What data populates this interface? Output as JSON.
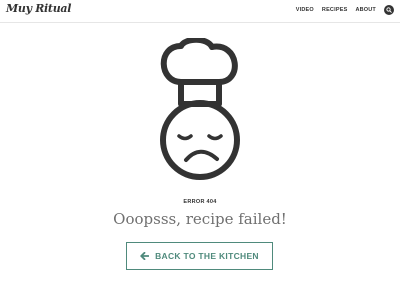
{
  "header": {
    "logo_text": "Muy Ritual",
    "nav": [
      {
        "label": "VIDEO"
      },
      {
        "label": "RECIPES"
      },
      {
        "label": "ABOUT"
      }
    ],
    "search_icon": "search-icon"
  },
  "main": {
    "illustration_icon": "sad-chef-icon",
    "error_code": "ERROR 404",
    "headline": "Ooopsss, recipe failed!",
    "back_button": {
      "label": "BACK TO THE KITCHEN",
      "icon": "arrow-left-icon"
    }
  },
  "colors": {
    "accent": "#4f8a7c",
    "text": "#333333",
    "headline": "#707070",
    "divider": "#e6e6e6"
  }
}
